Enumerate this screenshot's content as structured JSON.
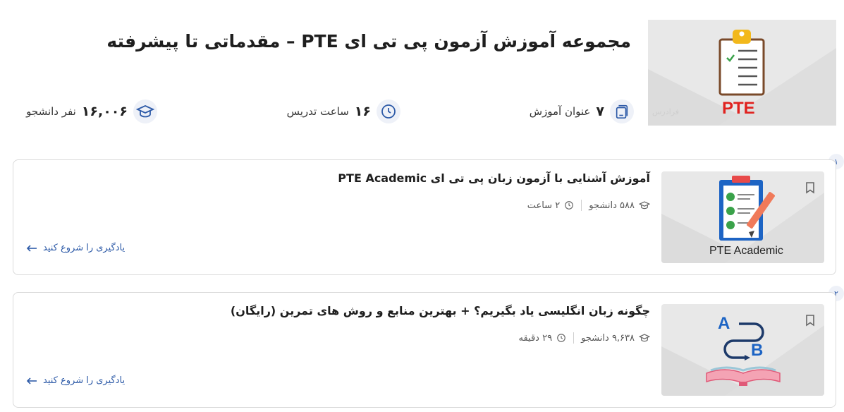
{
  "course": {
    "title": "مجموعه آموزش آزمون پی تی ای PTE – مقدماتی تا پیشرفته",
    "thumb_label": "PTE",
    "watermark": "فرادرس"
  },
  "stats": {
    "lessons": {
      "value": "۷",
      "label": "عنوان آموزش",
      "icon": "books-icon"
    },
    "hours": {
      "value": "۱۶",
      "label": "ساعت تدریس",
      "icon": "clock-icon"
    },
    "students": {
      "value": "۱۶,۰۰۶",
      "label": "نفر دانشجو",
      "icon": "graduation-cap-icon"
    }
  },
  "items": [
    {
      "index": "۱",
      "title": "آموزش آشنایی با آزمون زبان پی تی ای PTE Academic",
      "students": "۵۸۸ دانشجو",
      "duration": "۲ ساعت",
      "cta": "یادگیری را شروع کنید",
      "thumb_label": "PTE Academic"
    },
    {
      "index": "۲",
      "title": "چگونه زبان انگلیسی یاد بگیریم؟ + بهترین منابع و روش های تمرین (رایگان)",
      "students": "۹,۶۳۸ دانشجو",
      "duration": "۲۹ دقیقه",
      "cta": "یادگیری را شروع کنید",
      "thumb_label_a": "A",
      "thumb_label_b": "B"
    }
  ],
  "colors": {
    "accent": "#2e5ba8",
    "pte_red": "#e0221f",
    "thumb_bg": "#e8e8e8"
  }
}
